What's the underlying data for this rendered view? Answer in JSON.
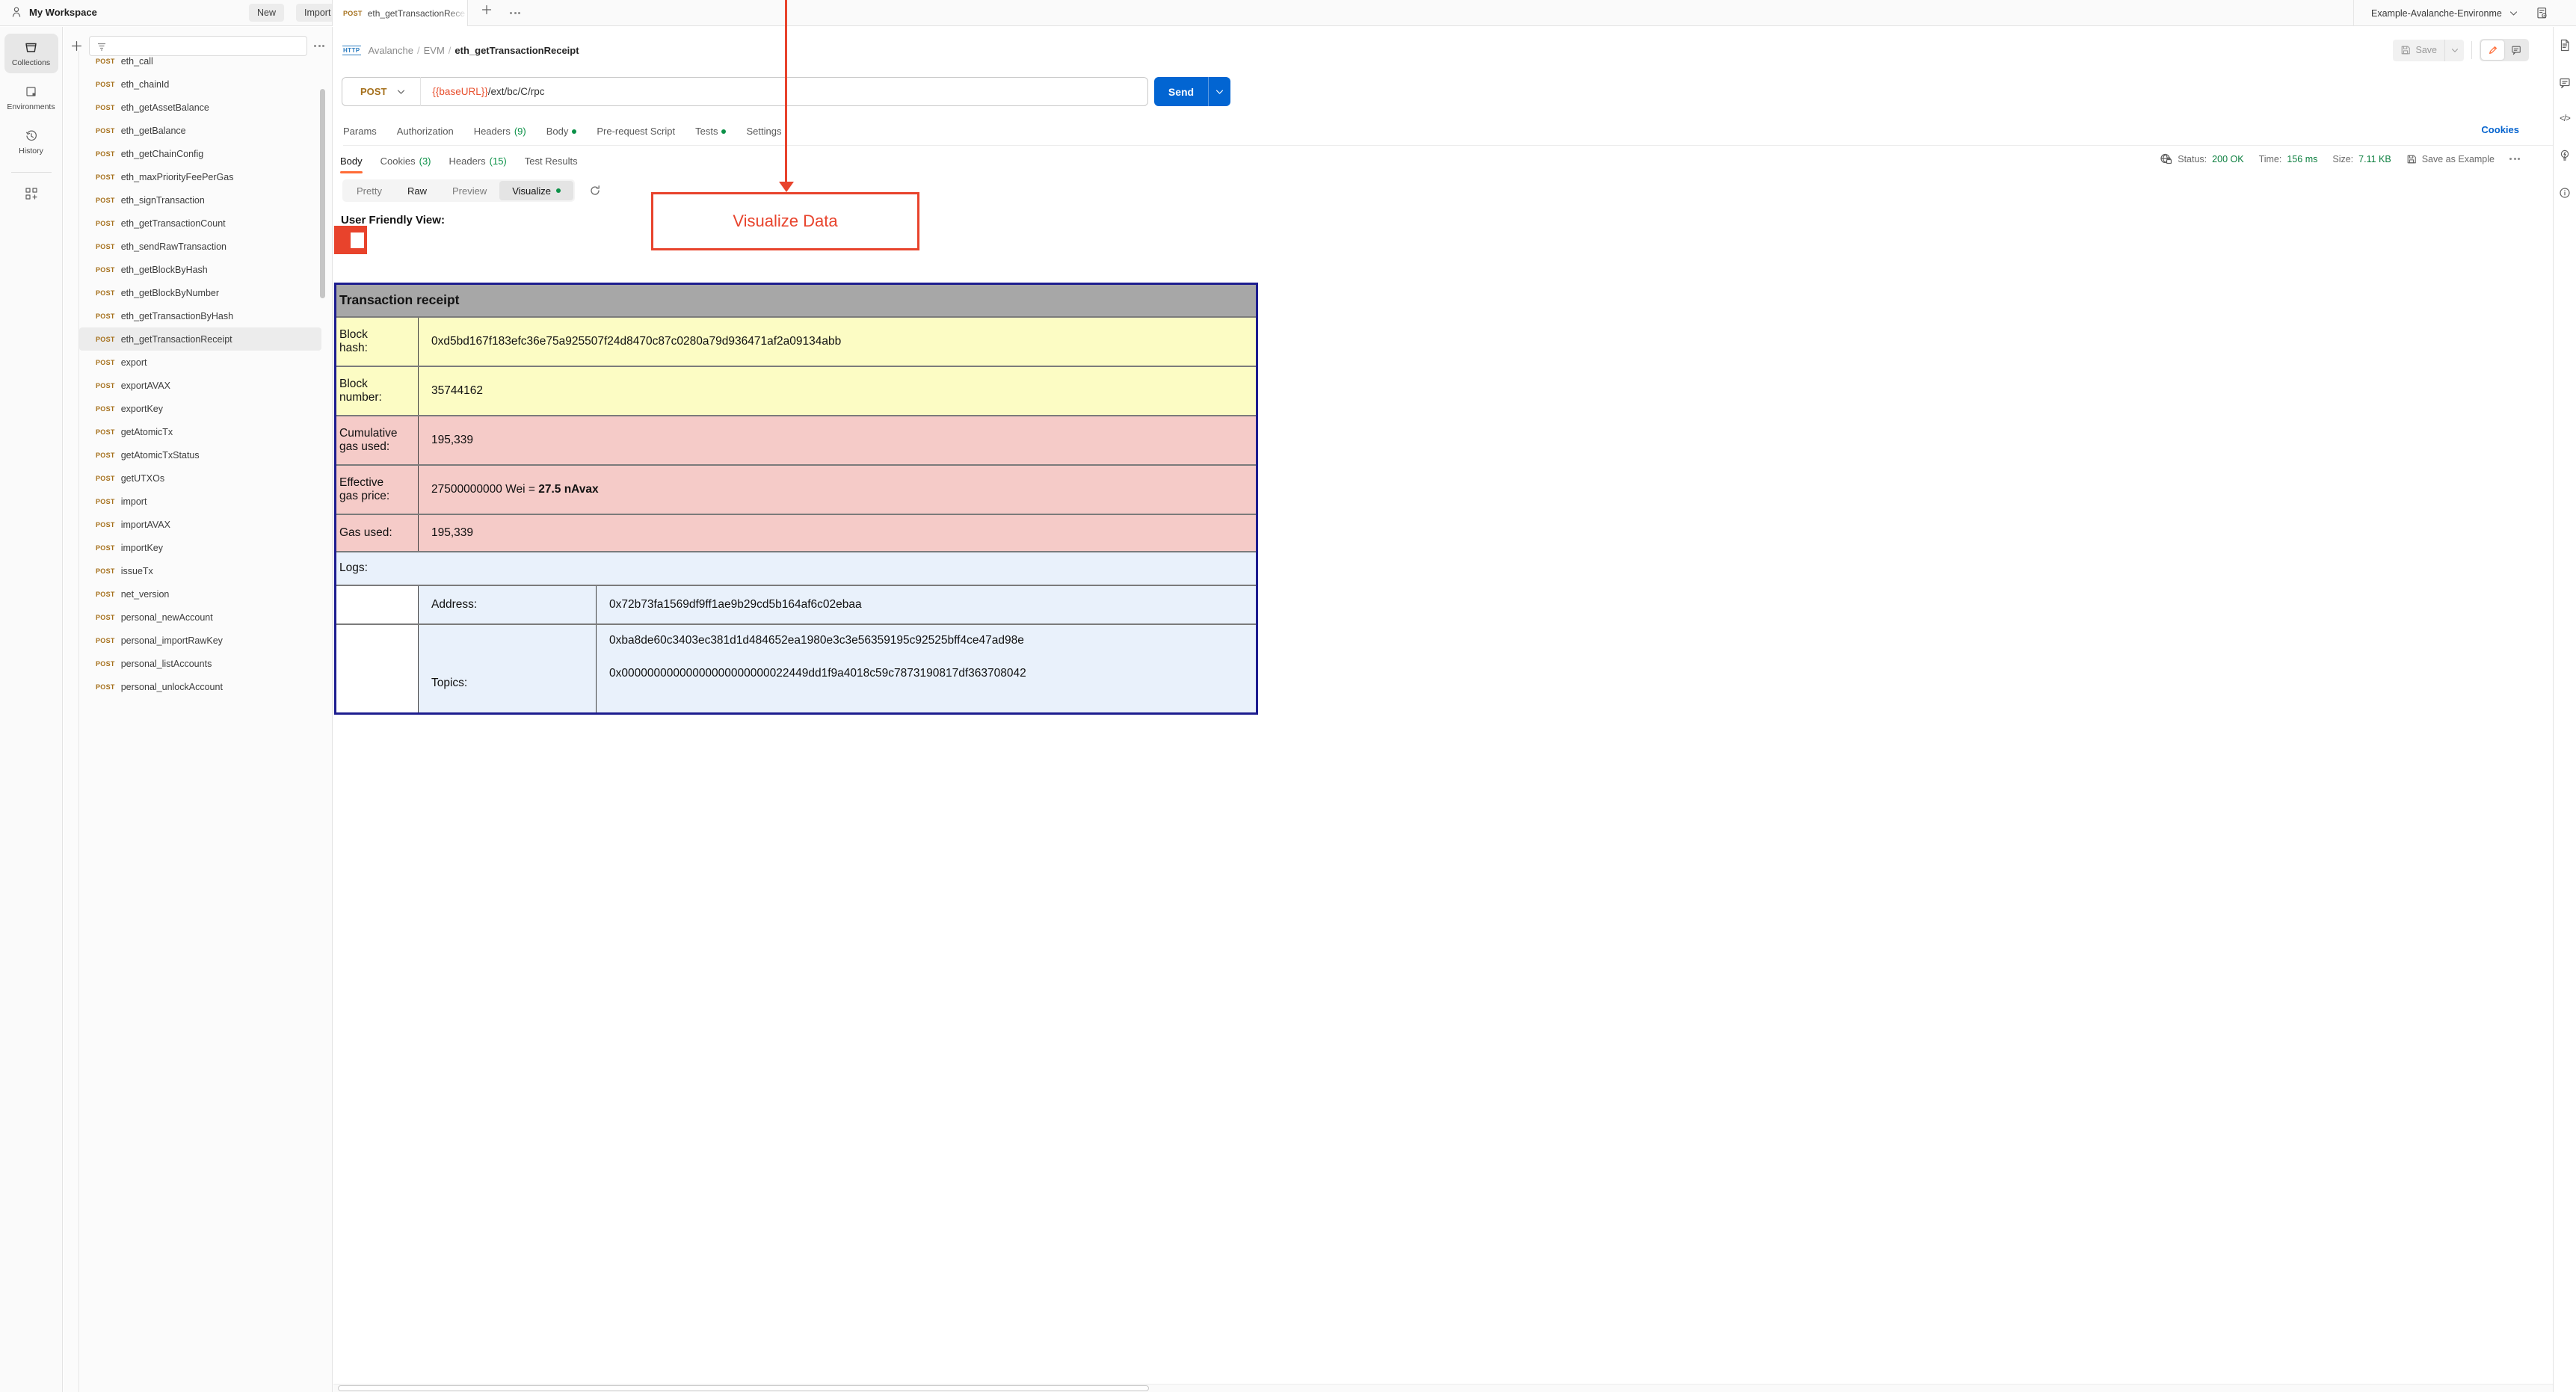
{
  "colors": {
    "accent_orange": "#FF6C37",
    "send_blue": "#0265D2",
    "link_blue": "#0765CF",
    "status_green": "#0C7F3F",
    "count_green": "#0C9148",
    "method_post_gold": "#A5701C",
    "annotation_red": "#E8432C",
    "table_border_navy": "#1D1D8F",
    "row_yellow": "#FCFCC4",
    "row_pink": "#F5CBC8",
    "row_blue": "#E9F1FB",
    "header_gray": "#A7A7A7"
  },
  "topbar": {
    "workspace": "My Workspace",
    "new_button": "New",
    "import_button": "Import",
    "tab_method": "POST",
    "tab_title": "eth_getTransactionRece",
    "environment": "Example-Avalanche-Environme"
  },
  "sidebar": {
    "method_label": "POST",
    "rail": [
      {
        "label": "Collections"
      },
      {
        "label": "Environments"
      },
      {
        "label": "History"
      }
    ],
    "items": [
      {
        "name": "eth_call",
        "state": ""
      },
      {
        "name": "eth_chainId",
        "state": ""
      },
      {
        "name": "eth_getAssetBalance",
        "state": ""
      },
      {
        "name": "eth_getBalance",
        "state": ""
      },
      {
        "name": "eth_getChainConfig",
        "state": ""
      },
      {
        "name": "eth_maxPriorityFeePerGas",
        "state": ""
      },
      {
        "name": "eth_signTransaction",
        "state": ""
      },
      {
        "name": "eth_getTransactionCount",
        "state": ""
      },
      {
        "name": "eth_sendRawTransaction",
        "state": ""
      },
      {
        "name": "eth_getBlockByHash",
        "state": ""
      },
      {
        "name": "eth_getBlockByNumber",
        "state": ""
      },
      {
        "name": "eth_getTransactionByHash",
        "state": ""
      },
      {
        "name": "eth_getTransactionReceipt",
        "state": "selected"
      },
      {
        "name": "export",
        "state": ""
      },
      {
        "name": "exportAVAX",
        "state": ""
      },
      {
        "name": "exportKey",
        "state": ""
      },
      {
        "name": "getAtomicTx",
        "state": ""
      },
      {
        "name": "getAtomicTxStatus",
        "state": ""
      },
      {
        "name": "getUTXOs",
        "state": ""
      },
      {
        "name": "import",
        "state": ""
      },
      {
        "name": "importAVAX",
        "state": ""
      },
      {
        "name": "importKey",
        "state": ""
      },
      {
        "name": "issueTx",
        "state": ""
      },
      {
        "name": "net_version",
        "state": ""
      },
      {
        "name": "personal_newAccount",
        "state": ""
      },
      {
        "name": "personal_importRawKey",
        "state": ""
      },
      {
        "name": "personal_listAccounts",
        "state": ""
      },
      {
        "name": "personal_unlockAccount",
        "state": ""
      }
    ]
  },
  "request": {
    "breadcrumb_root": "Avalanche",
    "breadcrumb_mid": "EVM",
    "breadcrumb_leaf": "eth_getTransactionReceipt",
    "save_label": "Save",
    "method": "POST",
    "url_variable": "{{baseURL}}",
    "url_path": "/ext/bc/C/rpc",
    "send_label": "Send",
    "tabs": [
      {
        "label": "Params"
      },
      {
        "label": "Authorization"
      },
      {
        "label": "Headers",
        "count": "(9)"
      },
      {
        "label": "Body",
        "dot": "on"
      },
      {
        "label": "Pre-request Script"
      },
      {
        "label": "Tests",
        "dot": "on"
      },
      {
        "label": "Settings"
      }
    ],
    "cookies_link": "Cookies"
  },
  "response": {
    "tabs": [
      {
        "label": "Body",
        "state": "active"
      },
      {
        "label": "Cookies",
        "count": "(3)"
      },
      {
        "label": "Headers",
        "count": "(15)"
      },
      {
        "label": "Test Results"
      }
    ],
    "status_label": "Status:",
    "status_value": "200 OK",
    "time_label": "Time:",
    "time_value": "156 ms",
    "size_label": "Size:",
    "size_value": "7.11 KB",
    "save_as_example": "Save as Example",
    "view_tabs": [
      {
        "label": "Pretty",
        "state": ""
      },
      {
        "label": "Raw",
        "state": "raw"
      },
      {
        "label": "Preview",
        "state": ""
      },
      {
        "label": "Visualize",
        "state": "active",
        "dot": "on"
      }
    ],
    "user_friendly_label": "User Friendly View:"
  },
  "annotation": {
    "label": "Visualize Data"
  },
  "table": {
    "title": "Transaction receipt",
    "rows": [
      {
        "label": "Block hash:",
        "value": "0xd5bd167f183efc36e75a925507f24d8470c87c0280a79d936471af2a09134abb",
        "bold": "",
        "color": "yellow",
        "size": "tall"
      },
      {
        "label": "Block number:",
        "value": "35744162",
        "bold": "",
        "color": "yellow",
        "size": ""
      },
      {
        "label": "Cumulative gas used:",
        "value": "195,339",
        "bold": "",
        "color": "pink",
        "size": ""
      },
      {
        "label": "Effective gas price:",
        "value": "27500000000 Wei = ",
        "bold": "27.5 nAvax",
        "color": "pink",
        "size": ""
      },
      {
        "label": "Gas used:",
        "value": "195,339",
        "bold": "",
        "color": "pink",
        "size": "short"
      }
    ],
    "logs_label": "Logs:",
    "address_label": "Address:",
    "address_value": "0x72b73fa1569df9ff1ae9b29cd5b164af6c02ebaa",
    "topics_label": "Topics:",
    "topics_values": [
      "0xba8de60c3403ec381d1d484652ea1980e3c3e56359195c92525bff4ce47ad98e",
      "0x00000000000000000000000022449dd1f9a4018c59c7873190817df363708042"
    ]
  }
}
